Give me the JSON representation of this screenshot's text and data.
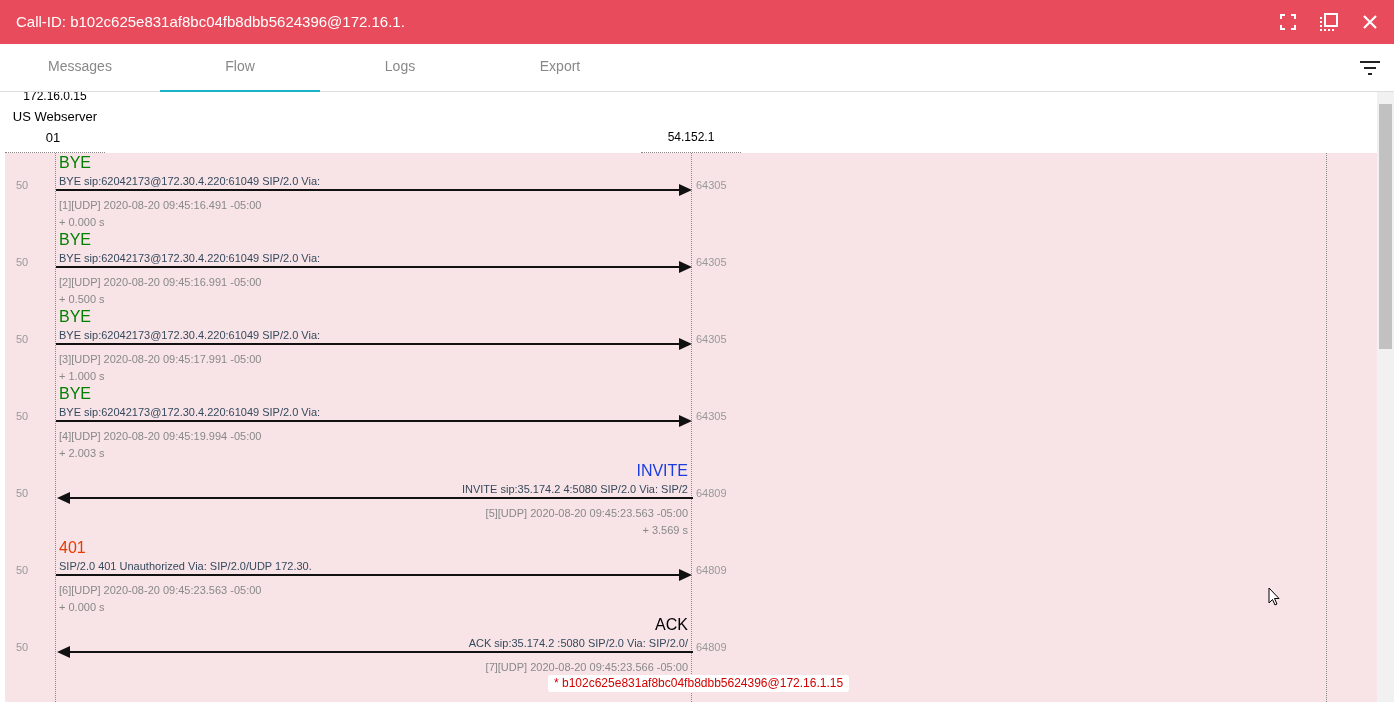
{
  "window": {
    "title": "Call-ID: b102c625e831af8bc04fb8dbb5624396@172.16.1."
  },
  "tabs": [
    {
      "label": "Messages",
      "selected": false
    },
    {
      "label": "Flow",
      "selected": true
    },
    {
      "label": "Logs",
      "selected": false
    },
    {
      "label": "Export",
      "selected": false
    }
  ],
  "hosts": [
    {
      "ip": "172.16.0.15",
      "name": "US Webserver",
      "suffix": "01"
    },
    {
      "ip": "54.152.1"
    }
  ],
  "messages": [
    {
      "method": "BYE",
      "color": "#008000",
      "kind": "outgoing",
      "summary": "BYE sip:62042173@172.30.4.220:61049 SIP/2.0 Via:",
      "meta": "[1][UDP] 2020-08-20 09:45:16.491 -05:00",
      "delta": "+ 0.000 s",
      "src_port": "50",
      "dst_port": "64305"
    },
    {
      "method": "BYE",
      "color": "#008000",
      "kind": "outgoing",
      "summary": "BYE sip:62042173@172.30.4.220:61049 SIP/2.0 Via:",
      "meta": "[2][UDP] 2020-08-20 09:45:16.991 -05:00",
      "delta": "+ 0.500 s",
      "src_port": "50",
      "dst_port": "64305"
    },
    {
      "method": "BYE",
      "color": "#008000",
      "kind": "outgoing",
      "summary": "BYE sip:62042173@172.30.4.220:61049 SIP/2.0 Via:",
      "meta": "[3][UDP] 2020-08-20 09:45:17.991 -05:00",
      "delta": "+ 1.000 s",
      "src_port": "50",
      "dst_port": "64305"
    },
    {
      "method": "BYE",
      "color": "#008000",
      "kind": "outgoing",
      "summary": "BYE sip:62042173@172.30.4.220:61049 SIP/2.0 Via:",
      "meta": "[4][UDP] 2020-08-20 09:45:19.994 -05:00",
      "delta": "+ 2.003 s",
      "src_port": "50",
      "dst_port": "64305"
    },
    {
      "method": "INVITE",
      "color": "#1a3de0",
      "kind": "incoming",
      "summary": "INVITE sip:35.174.2     4:5080 SIP/2.0 Via: SIP/2",
      "meta": "[5][UDP] 2020-08-20 09:45:23.563 -05:00",
      "delta": "+ 3.569 s",
      "src_port": "50",
      "dst_port": "64809"
    },
    {
      "method": "401",
      "color": "#e63a00",
      "kind": "outgoing",
      "summary": "SIP/2.0 401 Unauthorized Via: SIP/2.0/UDP 172.30.",
      "meta": "[6][UDP] 2020-08-20 09:45:23.563 -05:00",
      "delta": "+ 0.000 s",
      "src_port": "50",
      "dst_port": "64809"
    },
    {
      "method": "ACK",
      "color": "#000000",
      "kind": "incoming",
      "summary": "ACK sip:35.174.2      :5080 SIP/2.0 Via: SIP/2.0/",
      "meta": "[7][UDP] 2020-08-20 09:45:23.566 -05:00",
      "src_port": "50",
      "dst_port": "64809"
    }
  ],
  "tooltip": {
    "text": "* b102c625e831af8bc04fb8dbb5624396@172.16.1.15"
  }
}
